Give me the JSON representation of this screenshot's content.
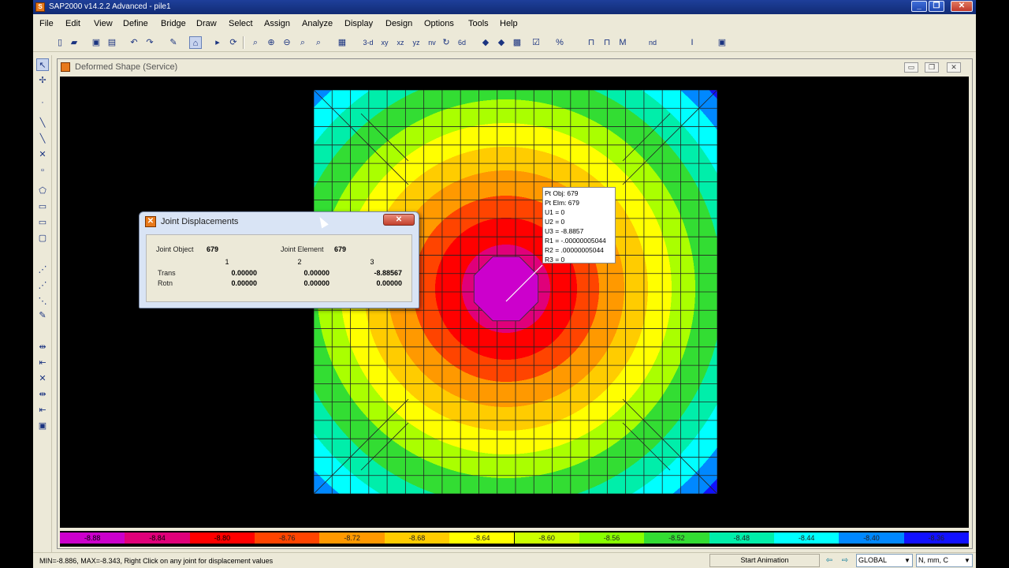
{
  "app": {
    "title": "SAP2000 v14.2.2 Advanced  - pile1",
    "icon": "sap-icon",
    "min_label": "_",
    "max_label": "❐",
    "close_label": "✕"
  },
  "menu": [
    "File",
    "Edit",
    "View",
    "Define",
    "Bridge",
    "Draw",
    "Select",
    "Assign",
    "Analyze",
    "Display",
    "Design",
    "Options",
    "Tools",
    "Help"
  ],
  "toolbar": {
    "labels": [
      "3-d",
      "xy",
      "xz",
      "yz",
      "nv",
      "↻",
      "6d"
    ]
  },
  "document": {
    "title": "Deformed Shape (Service)",
    "min_label": "▭",
    "max_label": "❐",
    "close_label": "✕"
  },
  "tooltip": {
    "lines": [
      "Pt Obj: 679",
      "Pt Elm: 679",
      "U1 = 0",
      "U2 = 0",
      "U3 = -8.8857",
      "R1 = -.00000005044",
      "R2 = .00000005044",
      "R3 = 0"
    ]
  },
  "dialog": {
    "title": "Joint Displacements",
    "close_label": "✕",
    "joint_object_label": "Joint Object",
    "joint_object_value": "679",
    "joint_element_label": "Joint Element",
    "joint_element_value": "679",
    "columns": [
      "1",
      "2",
      "3"
    ],
    "rows": [
      {
        "label": "Trans",
        "values": [
          "0.00000",
          "0.00000",
          "-8.88567"
        ]
      },
      {
        "label": "Rotn",
        "values": [
          "0.00000",
          "0.00000",
          "0.00000"
        ]
      }
    ]
  },
  "legend": {
    "values": [
      "-8.88",
      "-8.84",
      "-8.80",
      "-8.76",
      "-8.72",
      "-8.68",
      "-8.64",
      "-8.60",
      "-8.56",
      "-8.52",
      "-8.48",
      "-8.44",
      "-8.40",
      "-8.36"
    ],
    "colors": [
      "#cc00cc",
      "#e0007a",
      "#ff0000",
      "#ff4400",
      "#ff9900",
      "#ffcc00",
      "#ffff00",
      "#ccff00",
      "#88ff00",
      "#33dd33",
      "#00eeaa",
      "#00ffff",
      "#0088ff",
      "#1111ff"
    ]
  },
  "status": {
    "text": "MIN=-8.886, MAX=-8.343, Right Click on any joint for displacement values",
    "animation_button": "Start Animation",
    "coord_system": "GLOBAL",
    "units": "N, mm, C"
  }
}
